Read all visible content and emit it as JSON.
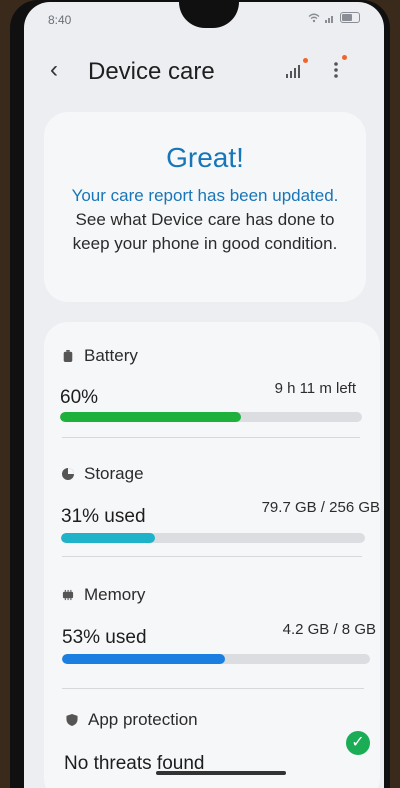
{
  "status_bar": {
    "time": "8:40",
    "icons": [
      "wifi-icon",
      "signal-icon",
      "battery-icon"
    ]
  },
  "header": {
    "title": "Device care",
    "icons": [
      "back-icon",
      "signal-bars-icon",
      "more-options-icon"
    ],
    "notification_dot_color": "#f0642c"
  },
  "summary": {
    "headline": "Great!",
    "message_highlight": "Your care report has been updated.",
    "message_rest": "See what Device care has done to keep your phone in good condition.",
    "accent_color": "#1876b8"
  },
  "battery": {
    "label": "Battery",
    "value": "60%",
    "detail": "9 h 11 m left",
    "level": 0.6,
    "color": "#1db13c"
  },
  "storage": {
    "label": "Storage",
    "value": "31% used",
    "detail": "79.7 GB / 256 GB",
    "level": 0.31,
    "color": "#1fb2c8"
  },
  "memory": {
    "label": "Memory",
    "value": "53% used",
    "detail": "4.2 GB / 8 GB",
    "level": 0.53,
    "color": "#1a7fe0"
  },
  "app_protection": {
    "label": "App protection",
    "value": "No threats found",
    "status_icon": "check-circle-icon",
    "status_color": "#1bad55"
  }
}
